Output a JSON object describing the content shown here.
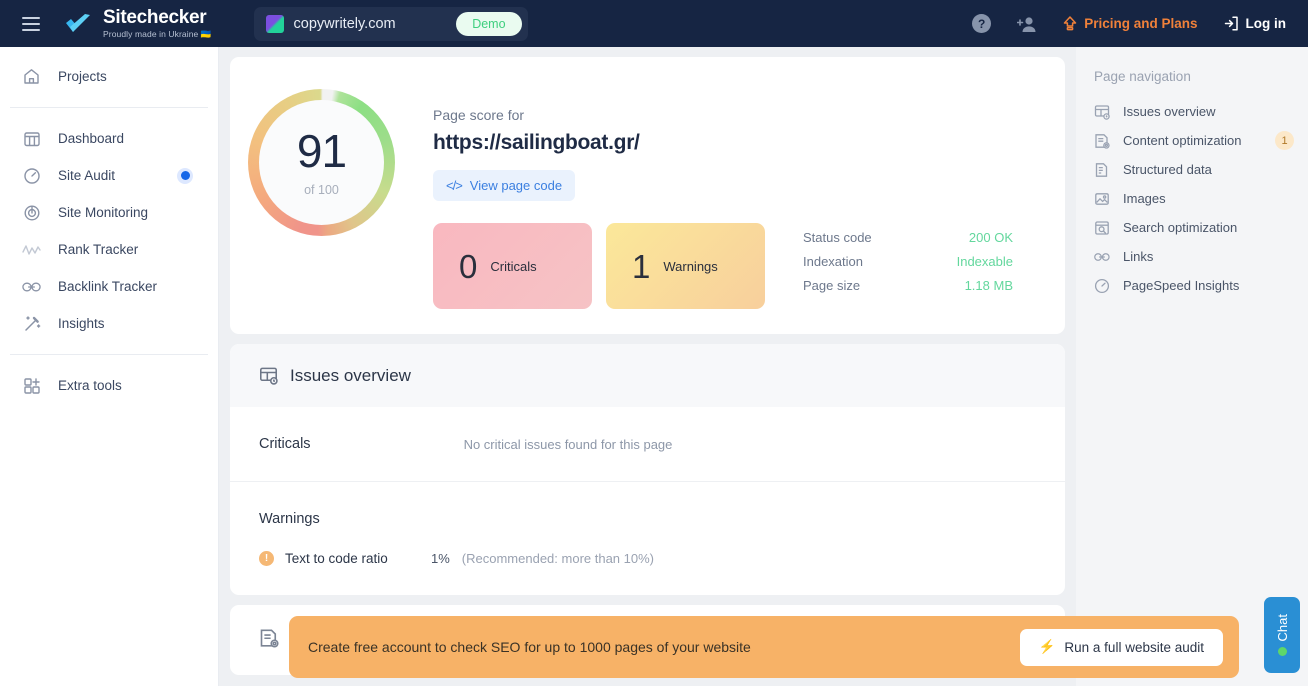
{
  "header": {
    "menu_icon": "hamburger-menu-icon",
    "brand_name": "Sitechecker",
    "brand_tagline": "Proudly made in Ukraine 🇺🇦",
    "site_tab": {
      "name": "copywritely.com",
      "badge": "Demo",
      "favicon": "copywritely-favicon"
    },
    "help_label": "?",
    "invite_icon": "add-user-icon",
    "pricing_label": "Pricing and Plans",
    "pricing_icon": "upgrade-arrow-icon",
    "login_label": "Log in",
    "login_icon": "login-arrow-icon",
    "colors": {
      "bar": "#162543",
      "tab": "#22314f",
      "pricing": "#f0813a",
      "demo": "#3ecf7e"
    }
  },
  "sidebar": {
    "group1": [
      {
        "label": "Projects",
        "icon": "home-icon"
      }
    ],
    "group2": [
      {
        "label": "Dashboard",
        "icon": "dashboard-columns-icon",
        "active": false
      },
      {
        "label": "Site Audit",
        "icon": "gauge-icon",
        "active": true
      },
      {
        "label": "Site Monitoring",
        "icon": "radar-icon",
        "active": false
      },
      {
        "label": "Rank Tracker",
        "icon": "chart-line-icon",
        "active": false
      },
      {
        "label": "Backlink Tracker",
        "icon": "link-chain-icon",
        "active": false
      },
      {
        "label": "Insights",
        "icon": "magic-wand-icon",
        "active": false
      }
    ],
    "group3": [
      {
        "label": "Extra tools",
        "icon": "grid-plus-icon"
      }
    ],
    "active_color": "#1667e8"
  },
  "page_navigation": {
    "title": "Page navigation",
    "items": [
      {
        "label": "Issues overview",
        "icon": "issues-overview-icon",
        "badge": ""
      },
      {
        "label": "Content optimization",
        "icon": "content-optimization-icon",
        "badge": "1"
      },
      {
        "label": "Structured data",
        "icon": "structured-data-icon",
        "badge": ""
      },
      {
        "label": "Images",
        "icon": "image-icon",
        "badge": ""
      },
      {
        "label": "Search optimization",
        "icon": "search-optimization-icon",
        "badge": ""
      },
      {
        "label": "Links",
        "icon": "links-icon",
        "badge": ""
      },
      {
        "label": "PageSpeed Insights",
        "icon": "pagespeed-icon",
        "badge": ""
      }
    ],
    "badge_color": "#fce8c9"
  },
  "score": {
    "value": "91",
    "of_label": "of 100",
    "label": "Page score for",
    "url": "https://sailingboat.gr/",
    "view_code_label": "View page code",
    "view_code_icon": "code-brackets-icon"
  },
  "stats": {
    "criticals": {
      "count": "0",
      "label": "Criticals",
      "color": "#f9b8c0"
    },
    "warnings": {
      "count": "1",
      "label": "Warnings",
      "color": "#fbe89a"
    }
  },
  "meta": [
    {
      "key": "Status code",
      "value": "200 OK"
    },
    {
      "key": "Indexation",
      "value": "Indexable"
    },
    {
      "key": "Page size",
      "value": "1.18 MB"
    }
  ],
  "issues_overview": {
    "title": "Issues overview",
    "icon": "issues-overview-icon",
    "criticals": {
      "heading": "Criticals",
      "empty_text": "No critical issues found for this page"
    },
    "warnings": {
      "heading": "Warnings",
      "rows": [
        {
          "icon": "warning-exclamation-icon",
          "name": "Text to code ratio",
          "value": "1%",
          "recommendation": "(Recommended: more than 10%)"
        }
      ]
    }
  },
  "third_card": {
    "icon": "content-optimization-icon"
  },
  "banner": {
    "text": "Create free account to check SEO for up to 1000 pages of your website",
    "button_label": "Run a full website audit",
    "button_icon": "lightning-bolt-icon",
    "color": "#f7b267"
  },
  "chat": {
    "label": "Chat",
    "status_icon": "online-status-dot",
    "color": "#2a8fd4"
  }
}
